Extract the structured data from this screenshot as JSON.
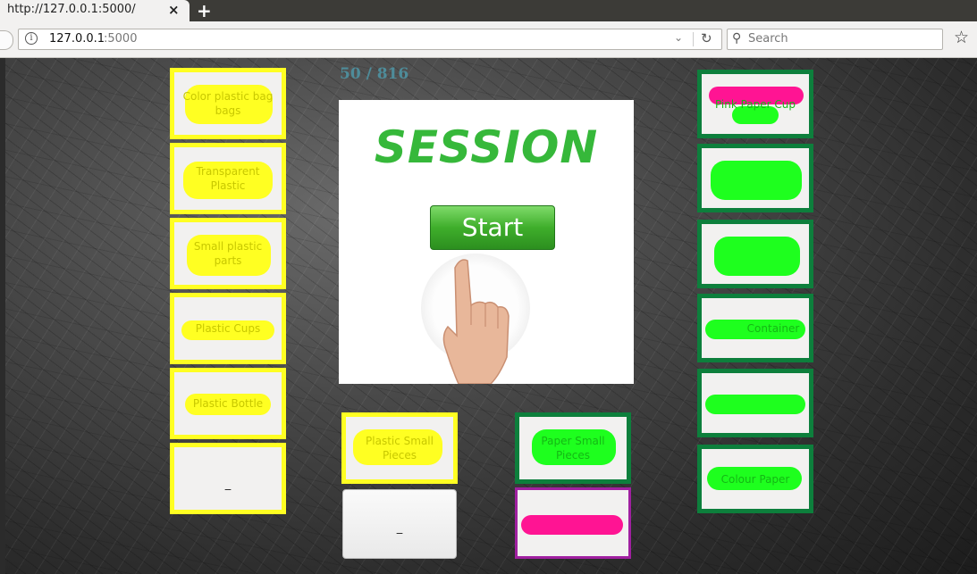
{
  "browser": {
    "tab_title": "http://127.0.0.1:5000/",
    "tab_close": "×",
    "new_tab": "+",
    "url_host": "127.0.0.1",
    "url_port": ":5000",
    "search_placeholder": "Search"
  },
  "game": {
    "counter": "50 / 816",
    "left_column": [
      {
        "label": "Color plastic bag bags"
      },
      {
        "label": "Transparent Plastic"
      },
      {
        "label": "Small plastic parts"
      },
      {
        "label": "Plastic Cups"
      },
      {
        "label": "Plastic Bottle"
      },
      {
        "label": "_"
      }
    ],
    "right_column": [
      {
        "label": "Pink Paper Cup"
      },
      {
        "label": ""
      },
      {
        "label": ""
      },
      {
        "label": "Container"
      },
      {
        "label": ""
      },
      {
        "label": "Colour Paper"
      }
    ],
    "bottom_middle": [
      {
        "label": "Plastic Small Pieces"
      },
      {
        "label": "_"
      },
      {
        "label": "Paper Small Pieces"
      },
      {
        "label": ""
      }
    ],
    "session": {
      "title": "SESSION",
      "start_label": "Start"
    }
  },
  "colors": {
    "yellow": "#ffff22",
    "green_border": "#0d7f3c",
    "green_fill": "#1eff1e",
    "pink_fill": "#ff1493",
    "purple_border": "#a020a0"
  }
}
